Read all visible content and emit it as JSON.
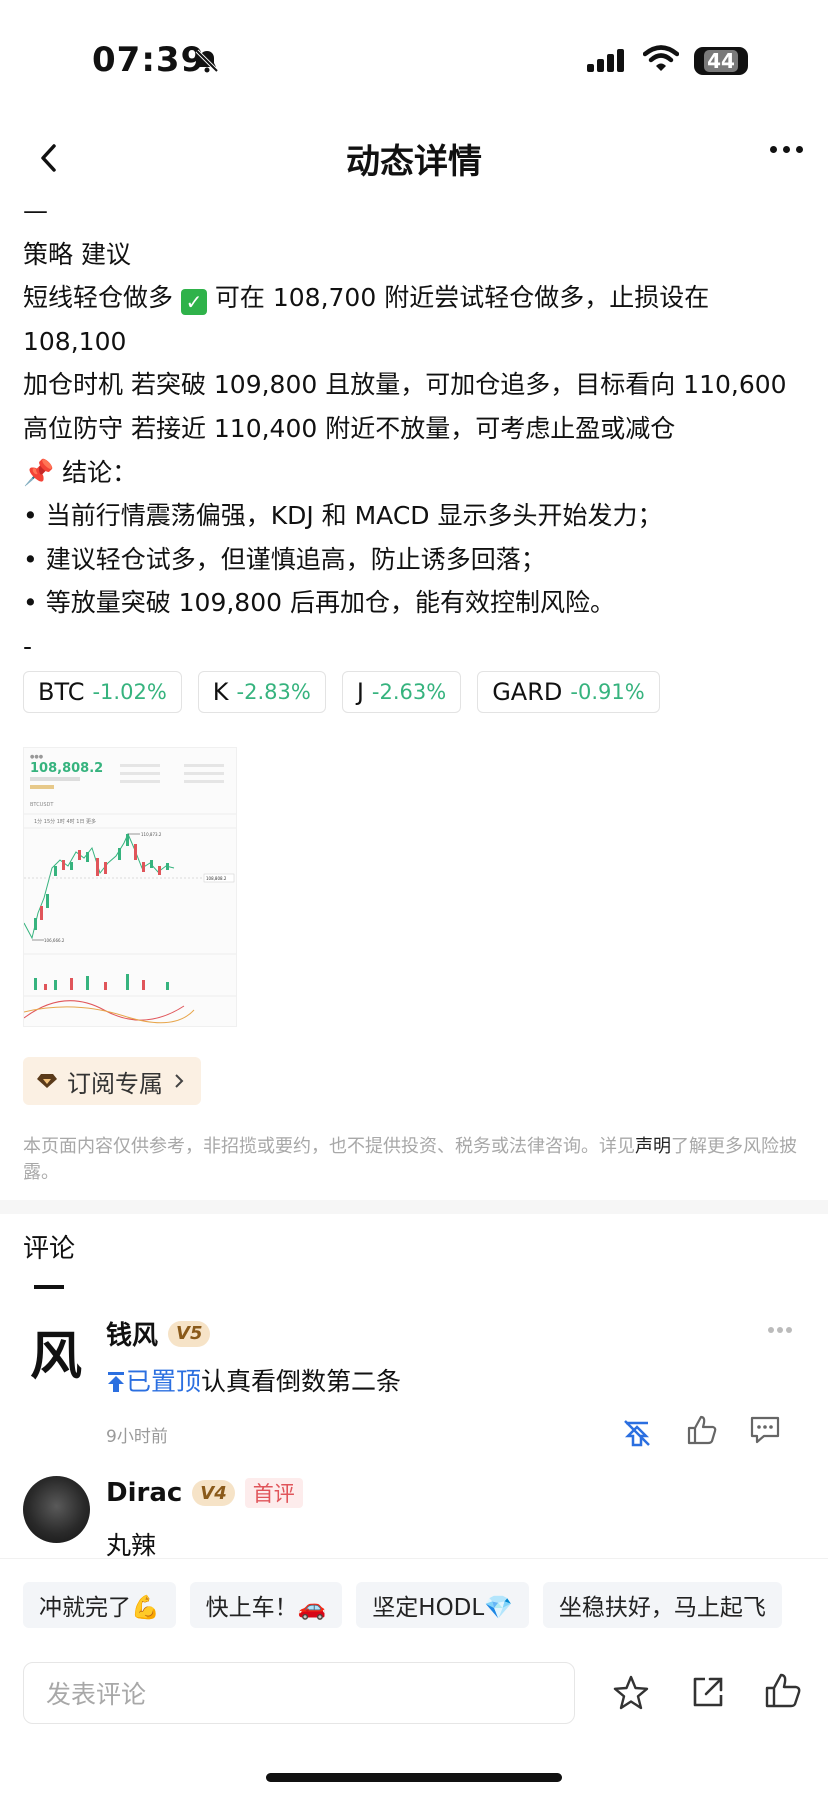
{
  "status_bar": {
    "time": "07:39",
    "battery": "44"
  },
  "nav": {
    "title": "动态详情"
  },
  "article": {
    "lines": {
      "dash_top": "—",
      "l1": "策略 建议",
      "l2_prefix": "短线轻仓做多",
      "l2_rest": " 可在 108,700 附近尝试轻仓做多，止损设在",
      "l3": "108,100",
      "l4": "加仓时机 若突破 109,800 且放量，可加仓追多，目标看向 110,600",
      "l5": "高位防守 若接近 110,400 附近不放量，可考虑止盈或减仓",
      "l6": "📌 结论：",
      "l7": "• 当前行情震荡偏强，KDJ 和 MACD 显示多头开始发力；",
      "l8": "• 建议轻仓试多，但谨慎追高，防止诱多回落；",
      "l9": "• 等放量突破 109,800 后再加仓，能有效控制风险。",
      "l10": "-"
    }
  },
  "tickers": [
    {
      "symbol": "BTC",
      "change": "-1.02%"
    },
    {
      "symbol": "K",
      "change": "-2.83%"
    },
    {
      "symbol": "J",
      "change": "-2.63%"
    },
    {
      "symbol": "GARD",
      "change": "-0.91%"
    }
  ],
  "thumbnail": {
    "price": "108,808.2",
    "pair": "BTCUSDT",
    "high_label": "110,873.2",
    "low_label": "106,666.2",
    "last_label": "108,808.2"
  },
  "subscribe": {
    "label": "订阅专属"
  },
  "disclaimer": {
    "before": "本页面内容仅供参考，非招揽或要约，也不提供投资、税务或法律咨询。详见",
    "link": "声明",
    "after": "了解更多风险披露。"
  },
  "comments": {
    "title": "评论",
    "items": [
      {
        "avatar_char": "风",
        "name": "钱风",
        "level": "V5",
        "pinned_label": "已置顶",
        "text": "认真看倒数第二条",
        "time": "9小时前"
      },
      {
        "name": "Dirac",
        "level": "V4",
        "badge": "首评",
        "text": "丸辣"
      }
    ]
  },
  "quick_replies": [
    "冲就完了💪",
    "快上车！🚗",
    "坚定HODL💎",
    "坐稳扶好，马上起飞"
  ],
  "composer": {
    "placeholder": "发表评论"
  },
  "colors": {
    "up_green": "#36b37e",
    "pin_blue": "#2b6fe0",
    "badge_gold": "#f6e3c7",
    "first_red": "#e0555a"
  },
  "icons": [
    "bell-muted-icon",
    "signal-icon",
    "wifi-icon",
    "back-icon",
    "more-icon",
    "diamond-icon",
    "chevron-right-icon",
    "pin-icon",
    "unpin-icon",
    "like-icon",
    "reply-icon",
    "star-icon",
    "share-icon"
  ]
}
